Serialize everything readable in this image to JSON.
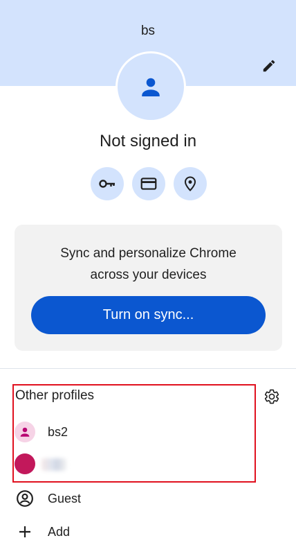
{
  "profile": {
    "name": "bs",
    "status": "Not signed in"
  },
  "quick_actions": [
    {
      "icon": "key-icon",
      "label": "Passwords"
    },
    {
      "icon": "credit-card-icon",
      "label": "Payment methods"
    },
    {
      "icon": "location-pin-icon",
      "label": "Addresses"
    }
  ],
  "sync": {
    "line1": "Sync and personalize Chrome",
    "line2": "across your devices",
    "button_label": "Turn on sync..."
  },
  "other_profiles": {
    "title": "Other profiles",
    "items": [
      {
        "name": "bs2",
        "avatar": "person-icon",
        "avatar_color": "#f6d3e6"
      },
      {
        "name": "",
        "avatar": "avatar",
        "avatar_color": "#c2185b",
        "name_obscured": true
      }
    ]
  },
  "actions": {
    "guest_label": "Guest",
    "add_label": "Add"
  },
  "colors": {
    "header_bg": "#d3e3fd",
    "accent": "#0b57d0",
    "card_bg": "#f2f2f2",
    "highlight": "#e0101e"
  }
}
